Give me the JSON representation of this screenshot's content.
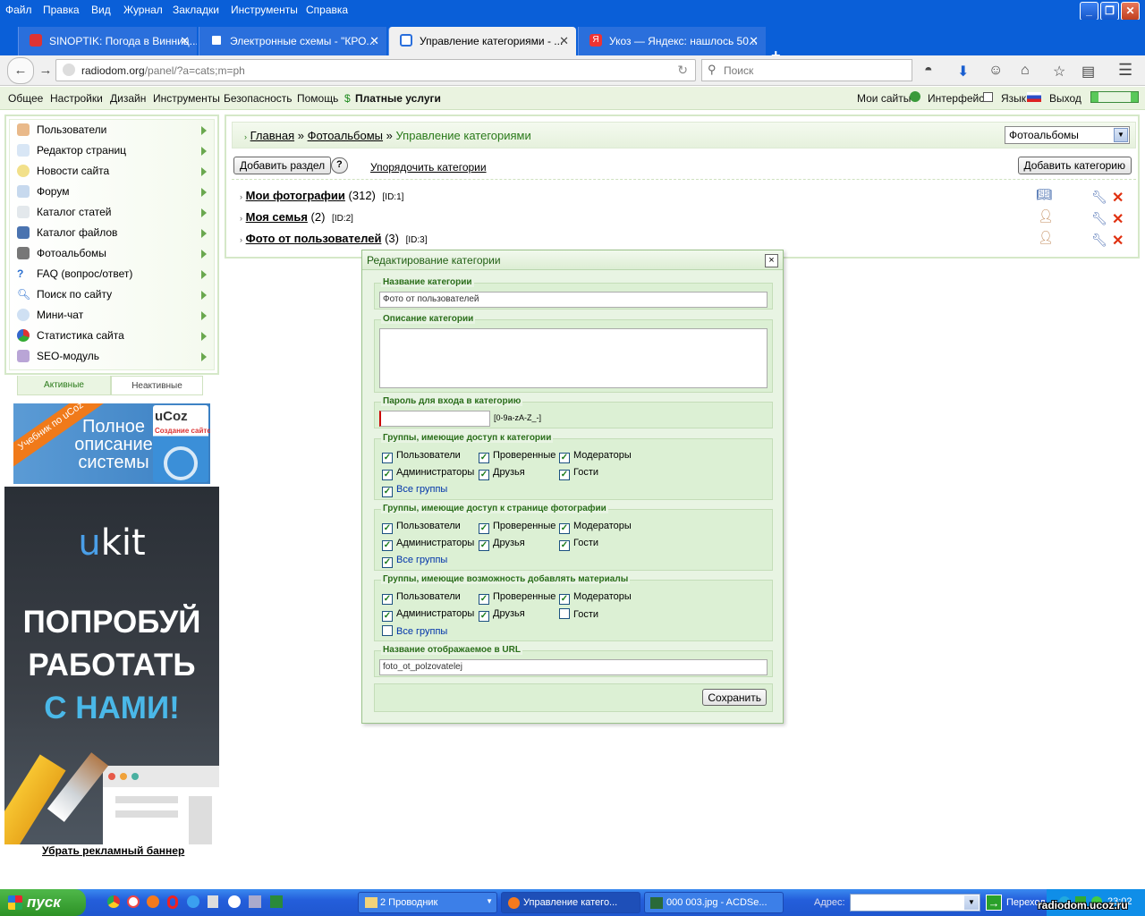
{
  "menubar": {
    "items": [
      "Файл",
      "Правка",
      "Вид",
      "Журнал",
      "Закладки",
      "Инструменты",
      "Справка"
    ]
  },
  "tabs": [
    {
      "title": "SINOPTIK: Погода в Винниц...",
      "active": false
    },
    {
      "title": "Электронные схемы - \"КРО...",
      "active": false
    },
    {
      "title": "Управление категориями - ...",
      "active": true
    },
    {
      "title": "Укоз — Яндекс: нашлось 50...",
      "active": false
    }
  ],
  "navbar": {
    "url_host": "radiodom.org",
    "url_path": "/panel/?a=cats;m=ph",
    "search_placeholder": "Поиск"
  },
  "panel": {
    "left_items": [
      "Общее",
      "Настройки",
      "Дизайн",
      "Инструменты",
      "Безопасность",
      "Помощь",
      "Платные услуги"
    ],
    "right_items": [
      "Мои сайты",
      "Интерфейс",
      "Язык",
      "Выход"
    ]
  },
  "sidebar": {
    "items": [
      "Пользователи",
      "Редактор страниц",
      "Новости сайта",
      "Форум",
      "Каталог статей",
      "Каталог файлов",
      "Фотоальбомы",
      "FAQ (вопрос/ответ)",
      "Поиск по сайту",
      "Мини-чат",
      "Статистика сайта",
      "SEO-модуль"
    ],
    "tab_active": "Активные",
    "tab_inactive": "Неактивные"
  },
  "ads": {
    "ad1_ribbon": "Учебник по uCoz",
    "ad1_line1": "Полное",
    "ad1_line2": "описание",
    "ad1_line3": "системы",
    "ad1_brand": "uCoz",
    "ad1_sub": "Создание сайтов",
    "ad2_logo_u": "u",
    "ad2_logo_kit": "kit",
    "ad2_line1": "ПОПРОБУЙ",
    "ad2_line2": "РАБОТАТЬ",
    "ad2_line3": "С НАМИ!",
    "remove": "Убрать рекламный баннер"
  },
  "content": {
    "crumb_home": "Главная",
    "crumb_sep": "»",
    "crumb_section": "Фотоальбомы",
    "crumb_current": "Управление категориями",
    "module_select": "Фотоальбомы",
    "add_section": "Добавить раздел",
    "help": "?",
    "sort_link": "Упорядочить категории",
    "add_category": "Добавить категорию",
    "categories": [
      {
        "name": "Мои фотографии",
        "count": "(312)",
        "id": "[ID:1]"
      },
      {
        "name": "Моя семья",
        "count": "(2)",
        "id": "[ID:2]"
      },
      {
        "name": "Фото от пользователей",
        "count": "(3)",
        "id": "[ID:3]"
      }
    ]
  },
  "dialog": {
    "title": "Редактирование категории",
    "close": "×",
    "name_label": "Название категории",
    "name_value": "Фото от пользователей",
    "desc_label": "Описание категории",
    "desc_value": "",
    "pass_label": "Пароль для входа в категорию",
    "pass_value": "",
    "pass_hint": "[0-9a-zA-Z_-]",
    "groups": [
      {
        "label": "Группы, имеющие доступ к категории",
        "checked": {
          "users": true,
          "verified": true,
          "moderators": true,
          "admins": true,
          "friends": true,
          "guests": true,
          "all": true
        }
      },
      {
        "label": "Группы, имеющие доступ к странице фотографии",
        "checked": {
          "users": true,
          "verified": true,
          "moderators": true,
          "admins": true,
          "friends": true,
          "guests": true,
          "all": true
        }
      },
      {
        "label": "Группы, имеющие возможность добавлять материалы",
        "checked": {
          "users": true,
          "verified": true,
          "moderators": true,
          "admins": true,
          "friends": true,
          "guests": false,
          "all": false
        }
      }
    ],
    "group_names": {
      "users": "Пользователи",
      "verified": "Проверенные",
      "moderators": "Модераторы",
      "admins": "Администраторы",
      "friends": "Друзья",
      "guests": "Гости",
      "all": "Все группы"
    },
    "url_label": "Название отображаемое в URL",
    "url_value": "foto_ot_polzovatelej",
    "save": "Сохранить"
  },
  "taskbar": {
    "start": "пуск",
    "tasks": [
      "2 Проводник",
      "Управление катего...",
      "000 003.jpg - ACDSe..."
    ],
    "address_label": "Адрес:",
    "go_label": "Переход",
    "clock": "23:02"
  },
  "watermark": "radiodom.ucoz.ru",
  "colors": {
    "xp_blue": "#0a5fd8",
    "panel_green": "#eaf3e0",
    "dialog_bg": "#e8f4e3",
    "legend_green": "#2a6e1a",
    "delete_red": "#e03010"
  }
}
